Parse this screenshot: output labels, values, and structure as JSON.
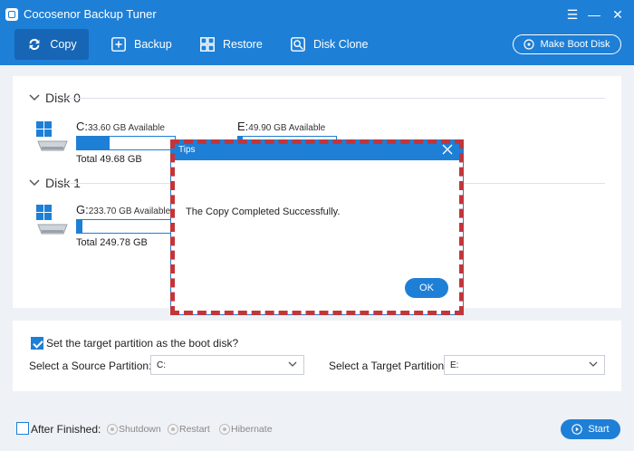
{
  "app": {
    "title": "Cocosenor Backup Tuner"
  },
  "toolbar": {
    "copy": "Copy",
    "backup": "Backup",
    "restore": "Restore",
    "disk_clone": "Disk Clone",
    "make_boot_disk": "Make Boot Disk"
  },
  "disks": [
    {
      "name": "Disk 0",
      "total": "Total 49.68 GB",
      "partitions": [
        {
          "letter": "C:",
          "available": "33.60 GB Available",
          "used_fraction": 0.33
        },
        {
          "letter": "E:",
          "available": "49.90 GB Available",
          "used_fraction": 0.05
        }
      ]
    },
    {
      "name": "Disk 1",
      "total": "Total 249.78 GB",
      "partitions": [
        {
          "letter": "G:",
          "available": "233.70 GB Available",
          "used_fraction": 0.06
        }
      ]
    }
  ],
  "options": {
    "boot_checkbox_label": "Set the target partition as the boot disk?",
    "boot_checked": true,
    "source_label": "Select a Source Partition:",
    "source_value": "C:",
    "target_label": "Select a Target Partition:",
    "target_value": "E:"
  },
  "footer": {
    "after_finished": "After Finished:",
    "shutdown": "Shutdown",
    "restart": "Restart",
    "hibernate": "Hibernate",
    "start": "Start"
  },
  "dialog": {
    "title": "Tips",
    "message": "The Copy Completed Successfully.",
    "ok": "OK"
  },
  "colors": {
    "accent": "#1e7fd6",
    "highlight_frame": "#c2353a",
    "background": "#eef1f6"
  }
}
